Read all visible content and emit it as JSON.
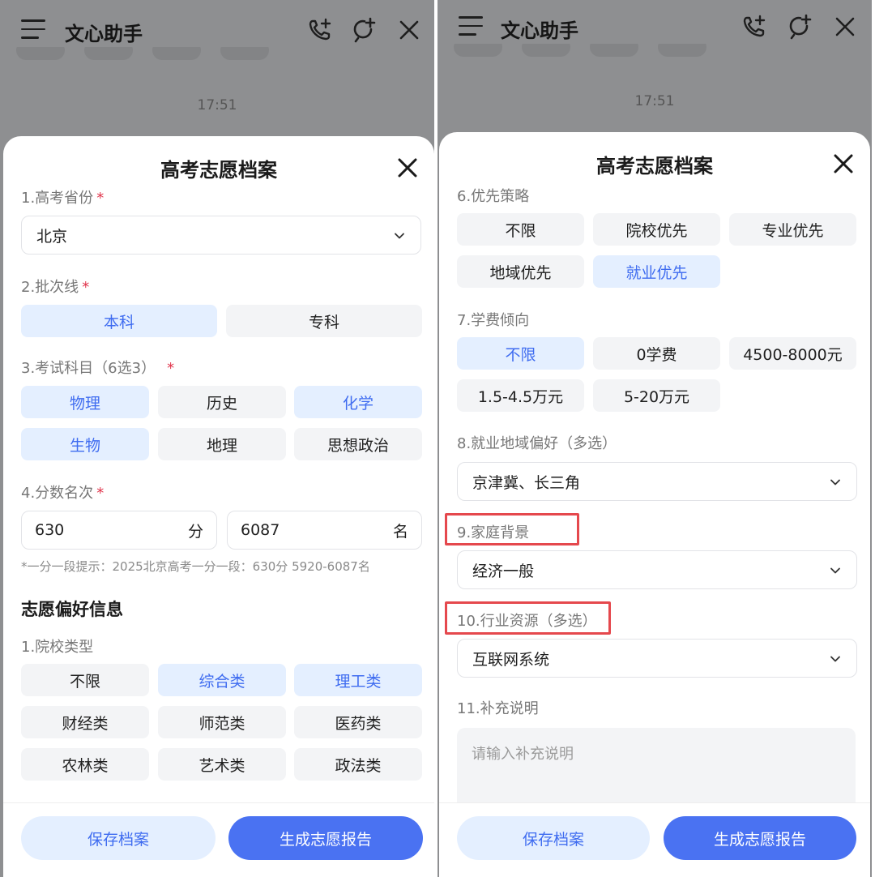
{
  "app": {
    "title": "文心助手",
    "time": "17:51"
  },
  "sheet": {
    "title": "高考志愿档案"
  },
  "left": {
    "province": {
      "label": "1.高考省份",
      "required": "*",
      "value": "北京"
    },
    "batch": {
      "label": "2.批次线",
      "required": "*",
      "options": [
        "本科",
        "专科"
      ],
      "selected": [
        "本科"
      ]
    },
    "subjects": {
      "label": "3.考试科目（6选3）",
      "required": "*",
      "options": [
        "物理",
        "历史",
        "化学",
        "生物",
        "地理",
        "思想政治"
      ],
      "selected": [
        "物理",
        "化学",
        "生物"
      ]
    },
    "score": {
      "label": "4.分数名次",
      "required": "*",
      "score_value": "630",
      "score_unit": "分",
      "rank_value": "6087",
      "rank_unit": "名"
    },
    "hint": "*一分一段提示：2025北京高考一分一段：630分 5920-6087名",
    "pref_title": "志愿偏好信息",
    "school_type": {
      "label": "1.院校类型",
      "options": [
        "不限",
        "综合类",
        "理工类",
        "财经类",
        "师范类",
        "医药类",
        "农林类",
        "艺术类",
        "政法类"
      ],
      "selected": [
        "综合类",
        "理工类"
      ]
    }
  },
  "right": {
    "strategy": {
      "label": "6.优先策略",
      "options": [
        "不限",
        "院校优先",
        "专业优先",
        "地域优先",
        "就业优先"
      ],
      "selected": [
        "就业优先"
      ]
    },
    "tuition": {
      "label": "7.学费倾向",
      "options": [
        "不限",
        "0学费",
        "4500-8000元",
        "1.5-4.5万元",
        "5-20万元"
      ],
      "selected": [
        "不限"
      ]
    },
    "job_region": {
      "label": "8.就业地域偏好（多选）",
      "value": "京津冀、长三角"
    },
    "family": {
      "label": "9.家庭背景",
      "value": "经济一般"
    },
    "industry": {
      "label": "10.行业资源（多选）",
      "value": "互联网系统"
    },
    "notes": {
      "label": "11.补充说明",
      "placeholder": "请输入补充说明"
    }
  },
  "footer": {
    "save_label": "保存档案",
    "generate_label": "生成志愿报告"
  },
  "colors": {
    "accent": "#4a72f2",
    "selected_bg": "#e4efff",
    "selected_text": "#3f6cf0",
    "chip_bg": "#f3f4f6",
    "required": "#e0334a",
    "highlight_box": "#e5484d"
  },
  "icons": [
    "menu-icon",
    "phone-add-icon",
    "new-chat-icon",
    "close-icon",
    "chevron-down-icon"
  ]
}
